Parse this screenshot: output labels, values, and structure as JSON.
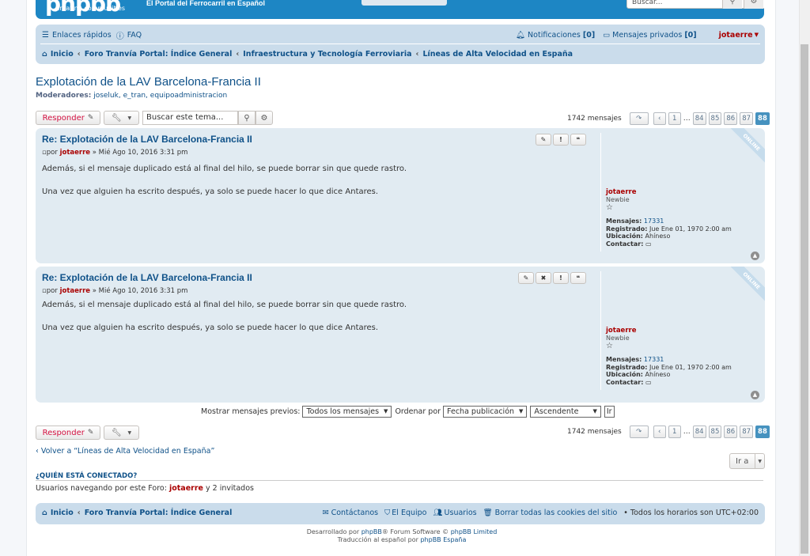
{
  "header": {
    "logo_text": "phpbb",
    "logo_sub": "creating communities",
    "site_desc": "El Portal del Ferrocarril en Español",
    "search_placeholder": "Buscar..."
  },
  "nav": {
    "quick_links": "Enlaces rápidos",
    "faq": "FAQ",
    "notifications": "Notificaciones",
    "notifications_count": "[0]",
    "private_messages": "Mensajes privados",
    "pm_count": "[0]",
    "username": "jotaerre",
    "breadcrumbs": [
      "Inicio",
      "Foro Tranvía Portal: Índice General",
      "Infraestructura y Tecnología Ferroviaria",
      "Líneas de Alta Velocidad en España"
    ]
  },
  "topic": {
    "title": "Explotación de la LAV Barcelona-Francia II",
    "moderators_label": "Moderadores:",
    "moderators": "joseluk, e_tran, equipoadministracion"
  },
  "actions": {
    "reply": "Responder",
    "search_topic_placeholder": "Buscar este tema...",
    "count": "1742 mensajes",
    "pages": [
      "1",
      "84",
      "85",
      "86",
      "87",
      "88"
    ],
    "ellipsis": "…"
  },
  "posts": [
    {
      "title": "Re: Explotación de la LAV Barcelona-Francia II",
      "by": "por",
      "author": "jotaerre",
      "date": "» Mié Ago 10, 2016 3:31 pm",
      "paragraphs": [
        "Además, si el mensaje duplicado está al final del hilo, se puede borrar sin que quede rastro.",
        "Una vez que alguien ha escrito después, ya solo se puede hacer lo que dice Antares."
      ],
      "online": "ONLINE",
      "profile": {
        "name": "jotaerre",
        "rank": "Newbie",
        "posts_label": "Mensajes:",
        "posts": "17331",
        "registered_label": "Registrado:",
        "registered": "Jue Ene 01, 1970 2:00 am",
        "location_label": "Ubicación:",
        "location": "Ahíneso",
        "contact_label": "Contactar:"
      }
    },
    {
      "title": "Re: Explotación de la LAV Barcelona-Francia II",
      "by": "por",
      "author": "jotaerre",
      "date": "» Mié Ago 10, 2016 3:31 pm",
      "paragraphs": [
        "Además, si el mensaje duplicado está al final del hilo, se puede borrar sin que quede rastro.",
        "Una vez que alguien ha escrito después, ya solo se puede hacer lo que dice Antares."
      ],
      "online": "ONLINE",
      "profile": {
        "name": "jotaerre",
        "rank": "Newbie",
        "posts_label": "Mensajes:",
        "posts": "17331",
        "registered_label": "Registrado:",
        "registered": "Jue Ene 01, 1970 2:00 am",
        "location_label": "Ubicación:",
        "location": "Ahíneso",
        "contact_label": "Contactar:"
      }
    }
  ],
  "sort": {
    "show_label": "Mostrar mensajes previos:",
    "show_value": "Todos los mensajes",
    "order_label": "Ordenar por",
    "order_value": "Fecha publicación",
    "dir_value": "Ascendente",
    "go": "Ir"
  },
  "bottom": {
    "back": "Volver a “Líneas de Alta Velocidad en España”",
    "goto": "Ir a",
    "who_title": "¿QUIÉN ESTÁ CONECTADO?",
    "who_prefix": "Usuarios navegando por este Foro:",
    "who_user": "jotaerre",
    "who_suffix": "y 2 invitados"
  },
  "footer": {
    "home": "Inicio",
    "index": "Foro Tranvía Portal: Índice General",
    "contact": "Contáctanos",
    "team": "El Equipo",
    "users": "Usuarios",
    "cookies": "Borrar todas las cookies del sitio",
    "timezone": "Todos los horarios son UTC+02:00",
    "powered_prefix": "Desarrollado por",
    "powered_link": "phpBB",
    "powered_mid": "® Forum Software ©",
    "powered_link2": "phpBB Limited",
    "translation_prefix": "Traducción al español por",
    "translation_link": "phpBB España"
  }
}
